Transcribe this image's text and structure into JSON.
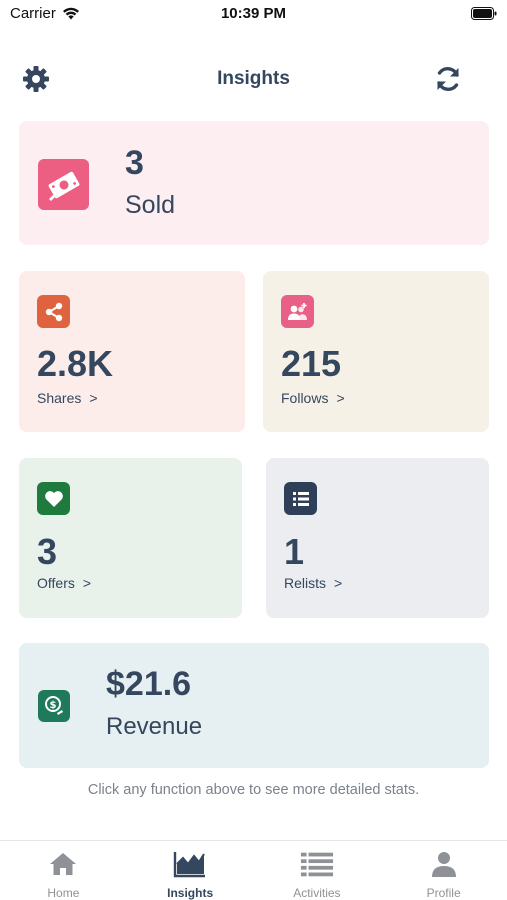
{
  "status_bar": {
    "carrier": "Carrier",
    "time": "10:39 PM"
  },
  "header": {
    "title": "Insights",
    "left_icon": "gear-icon",
    "right_icon": "refresh-icon"
  },
  "cards": {
    "sold": {
      "value": "3",
      "label": "Sold",
      "icon": "money-icon"
    },
    "shares": {
      "value": "2.8K",
      "label": "Shares",
      "icon": "share-icon"
    },
    "follows": {
      "value": "215",
      "label": "Follows",
      "icon": "follow-user-icon"
    },
    "offers": {
      "value": "3",
      "label": "Offers",
      "icon": "heart-icon"
    },
    "relists": {
      "value": "1",
      "label": "Relists",
      "icon": "list-icon"
    },
    "revenue": {
      "value": "$21.6",
      "label": "Revenue",
      "icon": "dollar-icon"
    }
  },
  "chevron": ">",
  "hint": "Click any function above to see more detailed stats.",
  "tabs": [
    {
      "label": "Home",
      "icon": "home-icon",
      "active": false
    },
    {
      "label": "Insights",
      "icon": "chart-icon",
      "active": true
    },
    {
      "label": "Activities",
      "icon": "list-icon",
      "active": false
    },
    {
      "label": "Profile",
      "icon": "person-icon",
      "active": false
    }
  ],
  "colors": {
    "text": "#34475f",
    "sold_bg": "#fdeef2",
    "shares_bg": "#fcecea",
    "follows_bg": "#f6f1e6",
    "offers_bg": "#e8f1ea",
    "relists_bg": "#ebedf0",
    "revenue_bg": "#e6eff1"
  }
}
